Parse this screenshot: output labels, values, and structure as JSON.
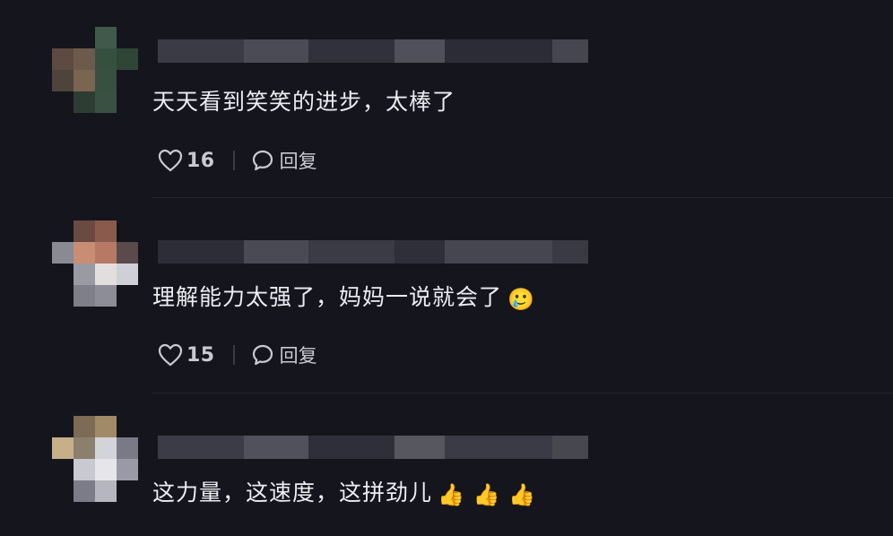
{
  "comments": [
    {
      "text": "天天看到笑笑的进步，太棒了",
      "emoji": "",
      "likes": "16",
      "reply_label": "回复",
      "avatar_colors": [
        "#15161d",
        "#15161d",
        "#3f5a48",
        "#15161d",
        "#5d4a40",
        "#6e5a4c",
        "#35503f",
        "#2f4536",
        "#4e443c",
        "#7a6551",
        "#38503f",
        "#15161d",
        "#15161d",
        "#2e3d33",
        "#3a5142",
        "#15161d"
      ],
      "username_colors": [
        "#3a3b45",
        "#4a4b55",
        "#30313a",
        "#4f505a",
        "#2b2c35",
        "#45464f"
      ]
    },
    {
      "text": "理解能力太强了，妈妈一说就会了",
      "emoji": "🥲",
      "likes": "15",
      "reply_label": "回复",
      "avatar_colors": [
        "#15161d",
        "#6b4a42",
        "#8a5b4d",
        "#15161d",
        "#8a8a94",
        "#c88d72",
        "#b57965",
        "#5a4a4a",
        "#15161d",
        "#9a9aa4",
        "#e3dede",
        "#cfcfd6",
        "#15161d",
        "#7f7f8a",
        "#8d8d97",
        "#15161d"
      ],
      "username_colors": [
        "#2c2d36",
        "#494a54",
        "#3a3b44",
        "#2e2f38",
        "#45464f",
        "#393a43"
      ]
    },
    {
      "text": "这力量，这速度，这拼劲儿",
      "emoji": "👍 👍 👍",
      "likes": "",
      "reply_label": "",
      "avatar_colors": [
        "#15161d",
        "#7d6b55",
        "#a08a68",
        "#15161d",
        "#c7b089",
        "#8b7f6d",
        "#d3d3da",
        "#7a7a86",
        "#15161d",
        "#c9c9d1",
        "#e6e6ea",
        "#9a9aa6",
        "#15161d",
        "#7c7c88",
        "#b6b6c0",
        "#15161d"
      ],
      "username_colors": [
        "#3b3c46",
        "#50515b",
        "#2e2f38",
        "#56575f",
        "#3a3b44",
        "#46474f"
      ]
    }
  ],
  "icons": {
    "like": "heart-outline-icon",
    "reply": "speech-bubble-icon"
  }
}
